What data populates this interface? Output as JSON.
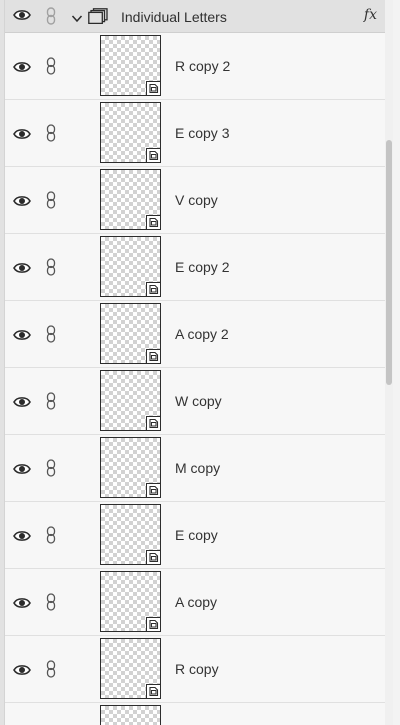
{
  "group": {
    "name": "Individual Letters",
    "fx_label": "fx"
  },
  "layers": [
    {
      "name": "R copy 2"
    },
    {
      "name": "E copy 3"
    },
    {
      "name": "V copy"
    },
    {
      "name": "E copy 2"
    },
    {
      "name": "A copy 2"
    },
    {
      "name": "W copy"
    },
    {
      "name": "M copy"
    },
    {
      "name": "E copy"
    },
    {
      "name": "A copy"
    },
    {
      "name": "R copy"
    }
  ],
  "icons": {
    "visibility": "eye-icon",
    "link": "chain-link-icon",
    "expand": "chevron-down-icon",
    "group": "group-folder-icon",
    "smart_object": "smart-object-icon",
    "effects": "fx-icon"
  }
}
